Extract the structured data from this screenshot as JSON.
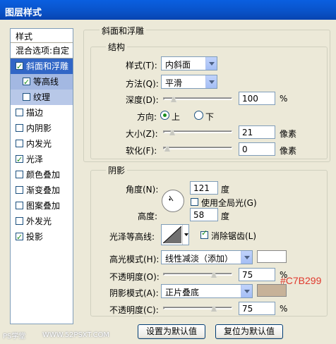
{
  "window": {
    "title": "图层样式"
  },
  "left": {
    "header": "样式",
    "blend": "混合选项:自定",
    "items": [
      {
        "label": "斜面和浮雕",
        "checked": true,
        "sel": true
      },
      {
        "label": "等高线",
        "checked": true,
        "sub": true
      },
      {
        "label": "纹理",
        "checked": false,
        "sub2": true
      },
      {
        "label": "描边",
        "checked": false
      },
      {
        "label": "内阴影",
        "checked": false
      },
      {
        "label": "内发光",
        "checked": false
      },
      {
        "label": "光泽",
        "checked": true
      },
      {
        "label": "颜色叠加",
        "checked": false
      },
      {
        "label": "渐变叠加",
        "checked": false
      },
      {
        "label": "图案叠加",
        "checked": false
      },
      {
        "label": "外发光",
        "checked": false
      },
      {
        "label": "投影",
        "checked": true
      }
    ]
  },
  "bevel": {
    "group_title": "斜面和浮雕",
    "structure_title": "结构",
    "style_label": "样式(T):",
    "style_value": "内斜面",
    "method_label": "方法(Q):",
    "method_value": "平滑",
    "depth_label": "深度(D):",
    "depth_value": "100",
    "depth_fraction": 0.1,
    "depth_unit": "%",
    "dir_label": "方向:",
    "dir_up": "上",
    "dir_down": "下",
    "size_label": "大小(Z):",
    "size_value": "21",
    "size_fraction": 0.08,
    "size_unit": "像素",
    "soften_label": "软化(F):",
    "soften_value": "0",
    "soften_fraction": 0.0,
    "soften_unit": "像素"
  },
  "shading": {
    "title": "阴影",
    "angle_label": "角度(N):",
    "angle_value": "121",
    "angle_unit": "度",
    "global_light_label": "使用全局光(G)",
    "altitude_label": "高度:",
    "altitude_value": "58",
    "altitude_unit": "度",
    "gloss_label": "光泽等高线:",
    "antialias_label": "消除锯齿(L)",
    "highlight_mode_label": "高光模式(H):",
    "highlight_mode_value": "线性减淡（添加）",
    "highlight_color": "#FFFFFF",
    "hl_opacity_label": "不透明度(O):",
    "hl_opacity_value": "75",
    "hl_opacity_fraction": 0.75,
    "pct": "%",
    "shadow_mode_label": "阴影模式(A):",
    "shadow_mode_value": "正片叠底",
    "shadow_color": "#C7B299",
    "shadow_color_hex_label": "#C7B299",
    "sh_opacity_label": "不透明度(C):",
    "sh_opacity_value": "75",
    "sh_opacity_fraction": 0.75
  },
  "buttons": {
    "make_default": "设置为默认值",
    "reset_default": "复位为默认值"
  },
  "watermark": {
    "left": "PS学堂",
    "right": "WWW.52PSXT.COM"
  }
}
